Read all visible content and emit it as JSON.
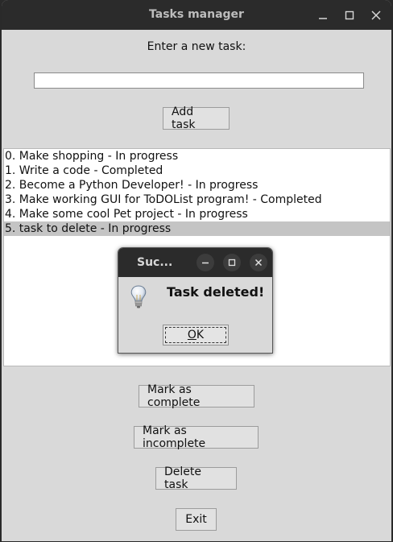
{
  "window": {
    "title": "Tasks manager"
  },
  "input": {
    "label": "Enter a new task:",
    "value": ""
  },
  "buttons": {
    "add": "Add task",
    "complete": "Mark as complete",
    "incomplete": "Mark as incomplete",
    "delete": "Delete task",
    "exit": "Exit"
  },
  "tasks": [
    "0. Make shopping - In progress",
    "1. Write a code - Completed",
    "2. Become a Python Developer! - In progress",
    "3. Make working GUI for ToDOList program! - Completed",
    "4. Make some cool Pet project - In progress",
    "5. task to delete - In progress"
  ],
  "selected_task_index": 5,
  "dialog": {
    "title": "Suc...",
    "message": "Task deleted!",
    "ok_mnemonic": "O",
    "ok_rest": "K",
    "icon": "lightbulb-icon"
  }
}
